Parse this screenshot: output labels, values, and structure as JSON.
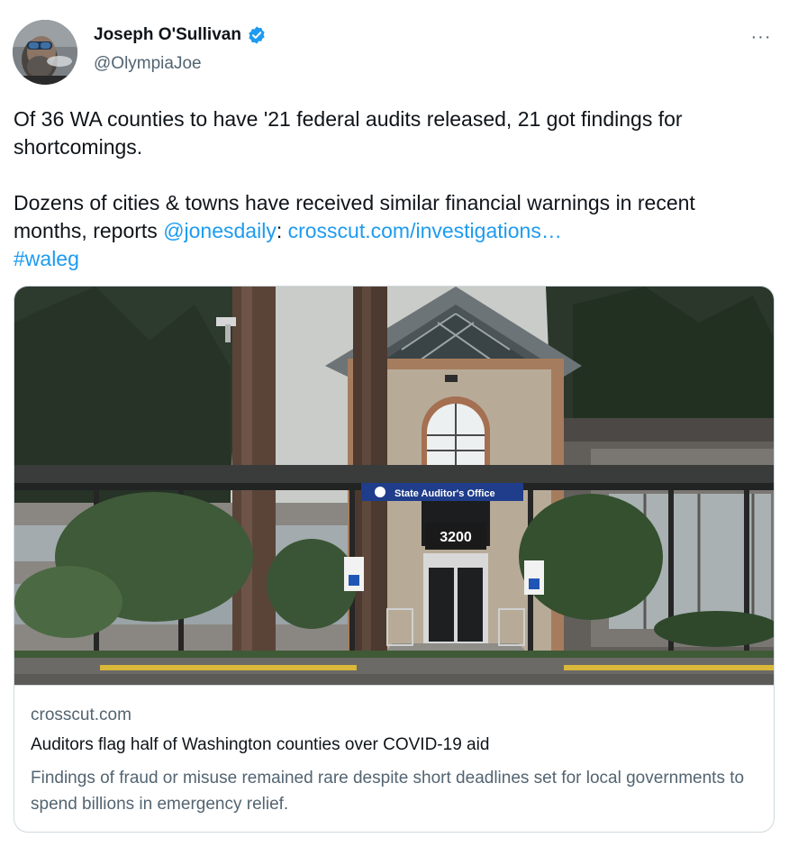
{
  "author": {
    "name": "Joseph O'Sullivan",
    "handle": "@OlympiaJoe",
    "verified_icon": "verified-badge-icon",
    "verified_color": "#1d9bf0"
  },
  "more_menu": {
    "label": "···",
    "icon": "more-horizontal-icon"
  },
  "tweet": {
    "line1": "Of 36 WA counties to have '21 federal audits released, 21 got findings for shortcomings.",
    "line2_prefix": "Dozens of cities & towns have received similar financial warnings in recent months, reports ",
    "mention": "@jonesdaily",
    "colon": ": ",
    "url": "crosscut.com/investigations…",
    "hashtag": "#waleg",
    "link_color": "#1d9bf0"
  },
  "card": {
    "image_sign": "State Auditor's Office",
    "image_address": "3200",
    "domain": "crosscut.com",
    "title": "Auditors flag half of Washington counties over COVID-19 aid",
    "description": "Findings of fraud or misuse remained rare despite short deadlines set for local governments to spend billions in emergency relief."
  }
}
